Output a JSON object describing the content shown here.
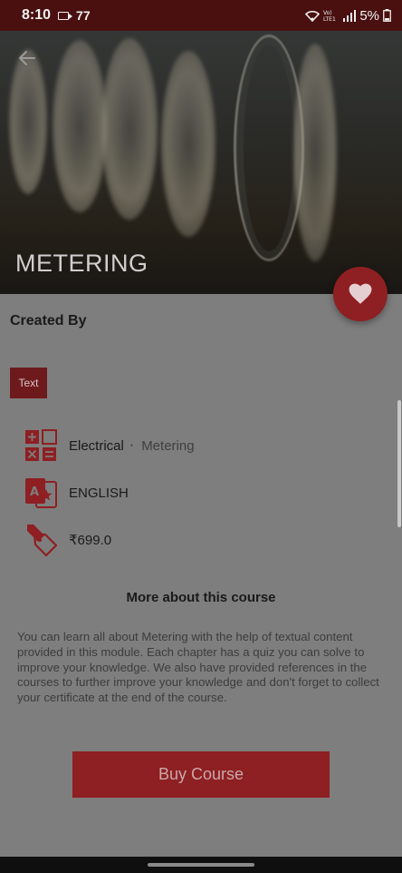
{
  "status_bar": {
    "time": "8:10",
    "notification_count": "77",
    "network_label": "Vo) LTE1",
    "battery": "5%"
  },
  "course": {
    "title": "METERING",
    "created_by_label": "Created By",
    "type_badge": "Text",
    "category": "Electrical",
    "category_separator": "·",
    "subcategory": "Metering",
    "language": "ENGLISH",
    "price": "₹699.0",
    "more_heading": "More about this course",
    "description": "You can learn all about Metering with the help of textual content provided in this module. Each chapter has a quiz you can solve to improve your knowledge. We also have provided references in the courses to further improve your knowledge and don't forget to collect your certificate at the end of the course."
  },
  "actions": {
    "buy_label": "Buy Course"
  },
  "icons": {
    "back": "arrow-left-icon",
    "favorite": "heart-icon",
    "category": "category-grid-icon",
    "language": "translate-icon",
    "price": "price-tag-icon"
  },
  "colors": {
    "accent": "#8e1f22",
    "status_bar": "#4a1010",
    "overlay": "#7e7e7e"
  }
}
